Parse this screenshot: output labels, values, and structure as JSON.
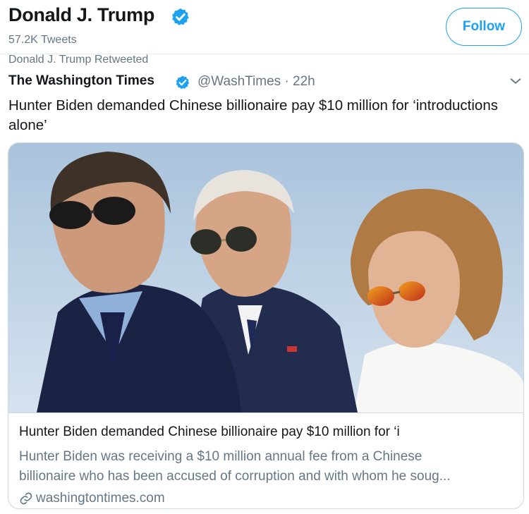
{
  "header": {
    "profile_name": "Donald J. Trump",
    "tweet_count": "57.2K Tweets",
    "follow_label": "Follow"
  },
  "tweet": {
    "retweeted_by": "Donald J. Trump Retweeted",
    "author_name": "The Washington Times",
    "handle_time": "@WashTimes · 22h",
    "text": "Hunter Biden demanded Chinese billionaire pay $10 million for ‘introductions alone’"
  },
  "card": {
    "title": "Hunter Biden demanded Chinese billionaire pay $10 million for ‘i",
    "description_line1": "Hunter Biden was receiving a $10 million annual fee from a Chinese",
    "description_line2": "billionaire who has been accused of corruption and with whom he soug...",
    "domain": "washingtontimes.com"
  },
  "colors": {
    "accent": "#1da1f2",
    "secondary_text": "#657786",
    "border": "#ccd6dd"
  },
  "icons": {
    "verified": "verified-badge-icon",
    "caret": "chevron-down-icon",
    "link": "link-icon"
  }
}
